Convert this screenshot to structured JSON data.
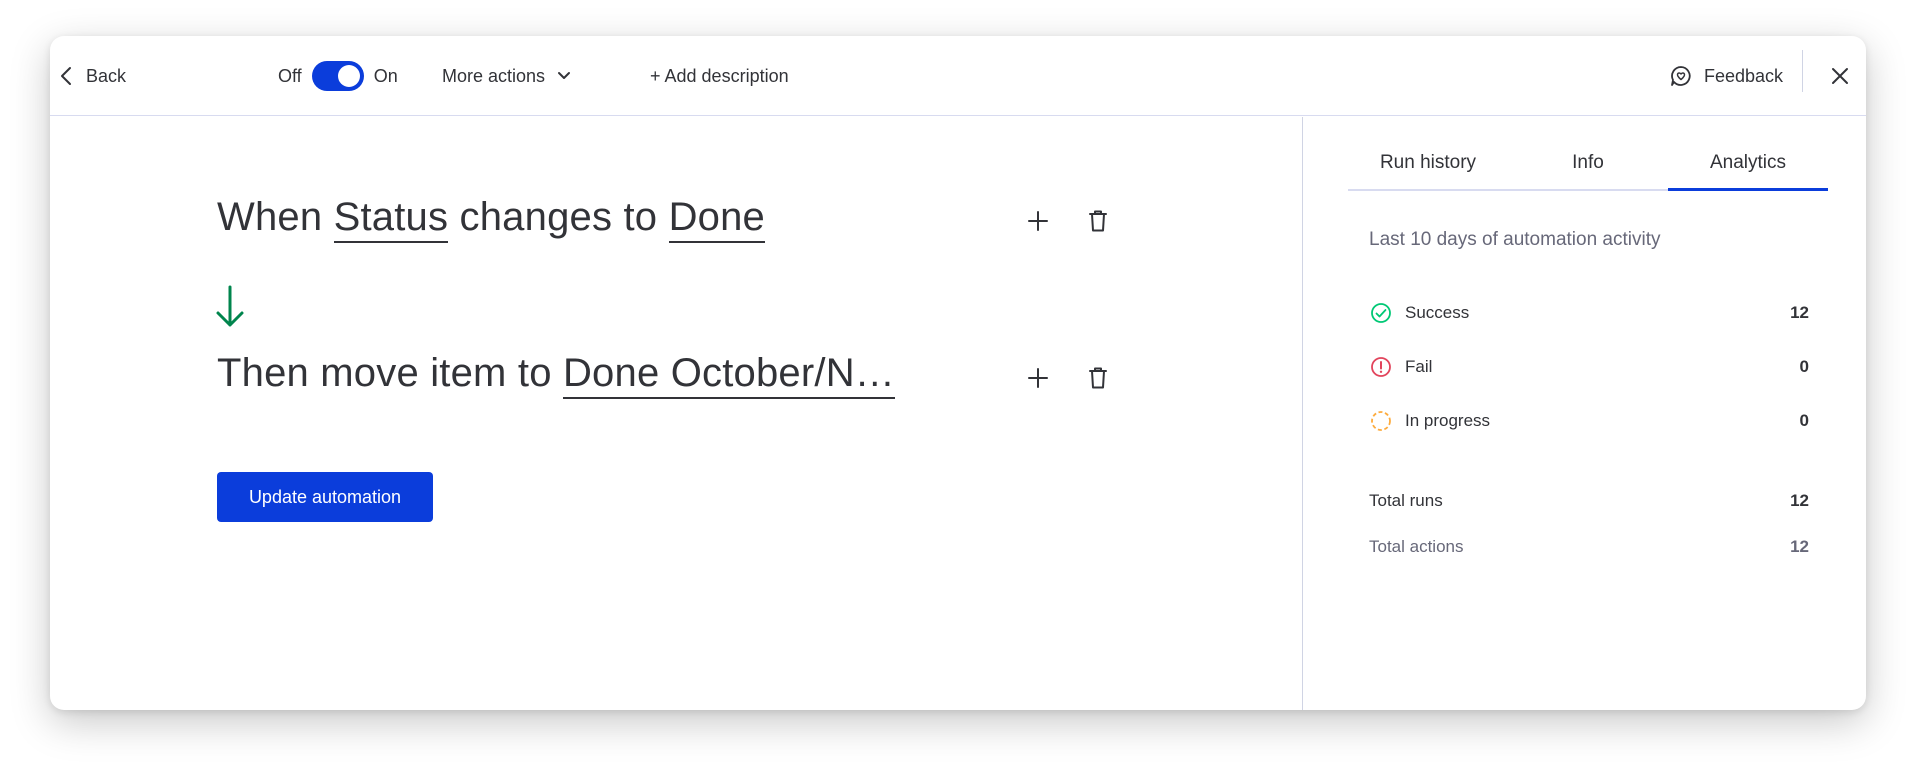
{
  "header": {
    "back_label": "Back",
    "toggle_off_label": "Off",
    "toggle_on_label": "On",
    "toggle_state": "on",
    "more_actions_label": "More actions",
    "add_description_label": "+ Add description",
    "feedback_label": "Feedback"
  },
  "builder": {
    "trigger": {
      "prefix": "When ",
      "field1": "Status",
      "middle": " changes to ",
      "field2": "Done"
    },
    "action": {
      "prefix": "Then move item to ",
      "field1": "Done October/N…"
    },
    "update_button_label": "Update automation"
  },
  "panel": {
    "tabs": [
      {
        "label": "Run history",
        "active": false
      },
      {
        "label": "Info",
        "active": false
      },
      {
        "label": "Analytics",
        "active": true
      }
    ],
    "subtitle": "Last 10 days of automation activity",
    "stats": [
      {
        "label": "Success",
        "value": "12",
        "icon": "check-circle-icon",
        "color": "#00c875"
      },
      {
        "label": "Fail",
        "value": "0",
        "icon": "alert-circle-icon",
        "color": "#e2445c"
      },
      {
        "label": "In progress",
        "value": "0",
        "icon": "progress-circle-icon",
        "color": "#fdab3d"
      }
    ],
    "totals": [
      {
        "label": "Total runs",
        "value": "12"
      },
      {
        "label": "Total actions",
        "value": "12"
      }
    ]
  },
  "colors": {
    "primary": "#0b3ddb",
    "arrow": "#00854d",
    "text": "#323338",
    "muted": "#676879"
  }
}
